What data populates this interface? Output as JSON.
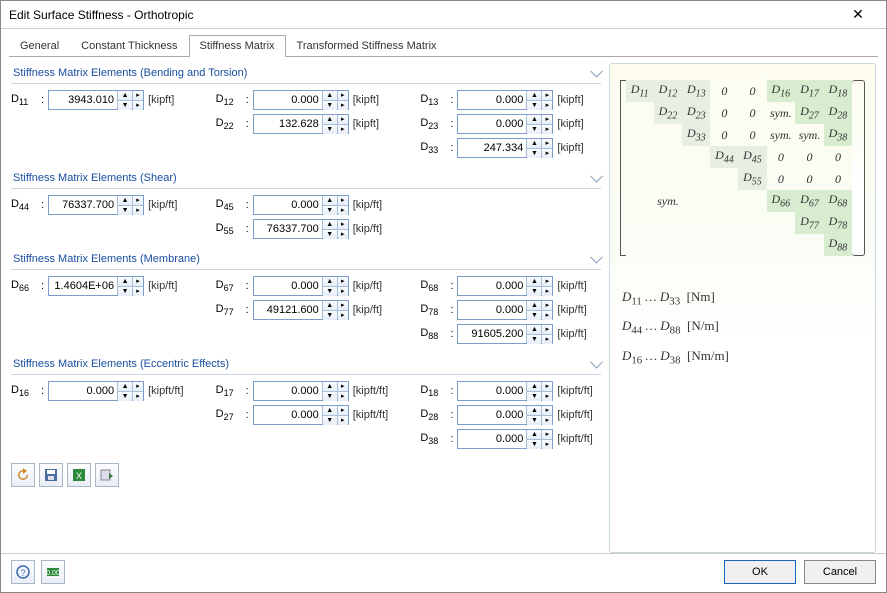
{
  "window": {
    "title": "Edit Surface Stiffness - Orthotropic"
  },
  "tabs": [
    "General",
    "Constant Thickness",
    "Stiffness Matrix",
    "Transformed Stiffness Matrix"
  ],
  "activeTab": 2,
  "groups": {
    "bending": {
      "title": "Stiffness Matrix Elements",
      "paren": "(Bending and Torsion)",
      "unit": "[kipft]",
      "entries": {
        "D11": "3943.010",
        "D12": "0.000",
        "D13": "0.000",
        "D22": "132.628",
        "D23": "0.000",
        "D33": "247.334"
      }
    },
    "shear": {
      "title": "Stiffness Matrix Elements",
      "paren": "(Shear)",
      "unit": "[kip/ft]",
      "entries": {
        "D44": "76337.700",
        "D45": "0.000",
        "D55": "76337.700"
      }
    },
    "membrane": {
      "title": "Stiffness Matrix Elements",
      "paren": "(Membrane)",
      "unit": "[kip/ft]",
      "entries": {
        "D66": "1.4604E+06",
        "D67": "0.000",
        "D68": "0.000",
        "D77": "49121.600",
        "D78": "0.000",
        "D88": "91605.200"
      }
    },
    "eccentric": {
      "title": "Stiffness Matrix Elements",
      "paren": "(Eccentric Effects)",
      "unit": "[kipft/ft]",
      "entries": {
        "D16": "0.000",
        "D17": "0.000",
        "D18": "0.000",
        "D27": "0.000",
        "D28": "0.000",
        "D38": "0.000"
      }
    }
  },
  "legend": {
    "l1a": "D",
    "l1b": "11",
    "l1c": " … D",
    "l1d": "33",
    "l1u": "[Nm]",
    "l2a": "D",
    "l2b": "44",
    "l2c": " … D",
    "l2d": "88",
    "l2u": "[N/m]",
    "l3a": "D",
    "l3b": "16",
    "l3c": " … D",
    "l3d": "38",
    "l3u": "[Nm/m]"
  },
  "matrix": {
    "sym": "sym."
  },
  "buttons": {
    "ok": "OK",
    "cancel": "Cancel"
  }
}
